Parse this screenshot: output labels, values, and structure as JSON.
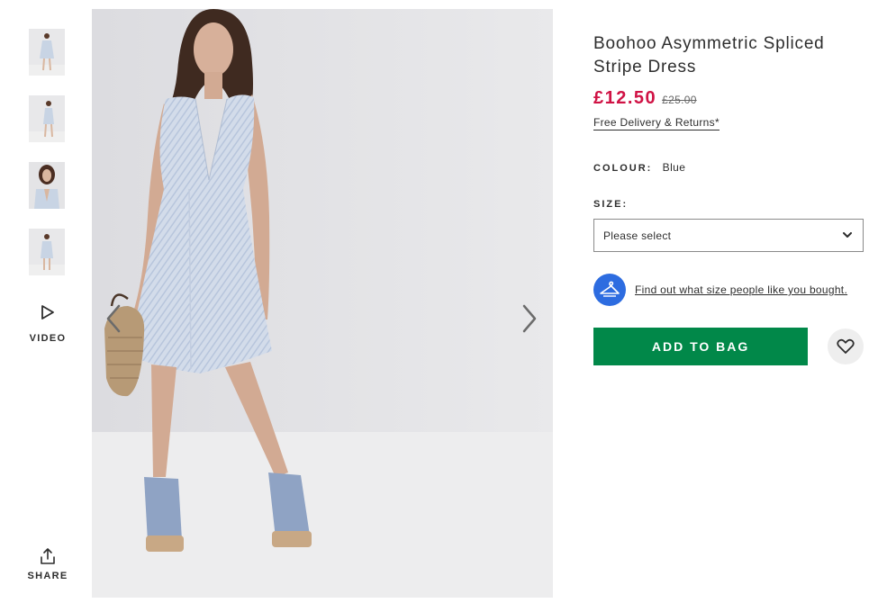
{
  "product": {
    "title_line1": "Boohoo Asymmetric Spliced",
    "title_line2": "Stripe Dress",
    "price_now": "£12.50",
    "price_was": "£25.00",
    "delivery_link": "Free Delivery & Returns*"
  },
  "colour": {
    "label": "COLOUR:",
    "value": "Blue"
  },
  "size": {
    "label": "SIZE:",
    "selected": "Please select",
    "chevron_icon": "chevron-down-icon"
  },
  "fit": {
    "icon": "hanger-icon",
    "link": "Find out what size people like you bought."
  },
  "actions": {
    "add_to_bag": "ADD TO BAG",
    "save_icon": "heart-icon"
  },
  "gallery": {
    "thumbnail_count": 4,
    "video_label": "VIDEO",
    "share_label": "SHARE",
    "prev_icon": "chevron-left-icon",
    "next_icon": "chevron-right-icon"
  },
  "colors": {
    "price": "#d01345",
    "add_to_bag": "#018849",
    "fit_icon_bg": "#2d6ce0",
    "image_bg": "#e6e6e8"
  }
}
